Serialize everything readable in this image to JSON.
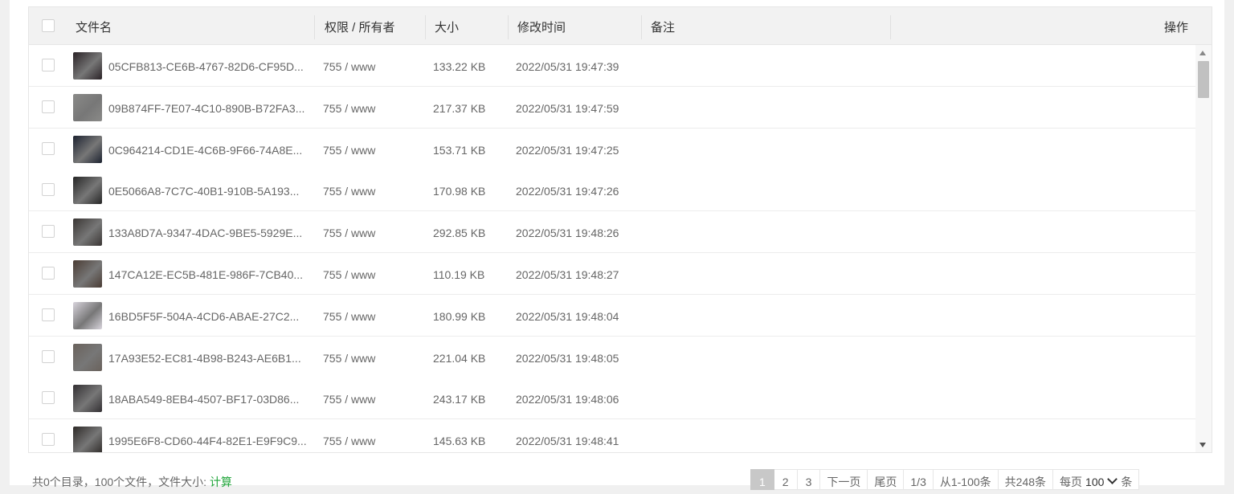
{
  "table": {
    "headers": {
      "name": "文件名",
      "perm": "权限 / 所有者",
      "size": "大小",
      "mtime": "修改时间",
      "note": "备注",
      "ops": "操作"
    },
    "rows": [
      {
        "name": "05CFB813-CE6B-4767-82D6-CF95D...",
        "perm": "755 / www",
        "size": "133.22 KB",
        "mtime": "2022/05/31 19:47:39"
      },
      {
        "name": "09B874FF-7E07-4C10-890B-B72FA3...",
        "perm": "755 / www",
        "size": "217.37 KB",
        "mtime": "2022/05/31 19:47:59"
      },
      {
        "name": "0C964214-CD1E-4C6B-9F66-74A8E...",
        "perm": "755 / www",
        "size": "153.71 KB",
        "mtime": "2022/05/31 19:47:25"
      },
      {
        "name": "0E5066A8-7C7C-40B1-910B-5A193...",
        "perm": "755 / www",
        "size": "170.98 KB",
        "mtime": "2022/05/31 19:47:26"
      },
      {
        "name": "133A8D7A-9347-4DAC-9BE5-5929E...",
        "perm": "755 / www",
        "size": "292.85 KB",
        "mtime": "2022/05/31 19:48:26"
      },
      {
        "name": "147CA12E-EC5B-481E-986F-7CB40...",
        "perm": "755 / www",
        "size": "110.19 KB",
        "mtime": "2022/05/31 19:48:27"
      },
      {
        "name": "16BD5F5F-504A-4CD6-ABAE-27C2...",
        "perm": "755 / www",
        "size": "180.99 KB",
        "mtime": "2022/05/31 19:48:04"
      },
      {
        "name": "17A93E52-EC81-4B98-B243-AE6B1...",
        "perm": "755 / www",
        "size": "221.04 KB",
        "mtime": "2022/05/31 19:48:05"
      },
      {
        "name": "18ABA549-8EB4-4507-BF17-03D86...",
        "perm": "755 / www",
        "size": "243.17 KB",
        "mtime": "2022/05/31 19:48:06"
      },
      {
        "name": "1995E6F8-CD60-44F4-82E1-E9F9C9...",
        "perm": "755 / www",
        "size": "145.63 KB",
        "mtime": "2022/05/31 19:48:41"
      }
    ],
    "thumb_colors": [
      "#2a2226",
      "#8a8a88",
      "#1c2230",
      "#262626",
      "#3a3634",
      "#4a3c34",
      "#d8d4dc",
      "#6a625c",
      "#333033",
      "#2e2a28"
    ]
  },
  "footer": {
    "summary": "共0个目录，100个文件，文件大小:",
    "calc_link": "计算"
  },
  "pager": {
    "pages": [
      "1",
      "2",
      "3"
    ],
    "next": "下一页",
    "last": "尾页",
    "page_of": "1/3",
    "range": "从1-100条",
    "total": "共248条",
    "per_page_label": "每页",
    "per_page_value": "100",
    "unit": "条"
  }
}
